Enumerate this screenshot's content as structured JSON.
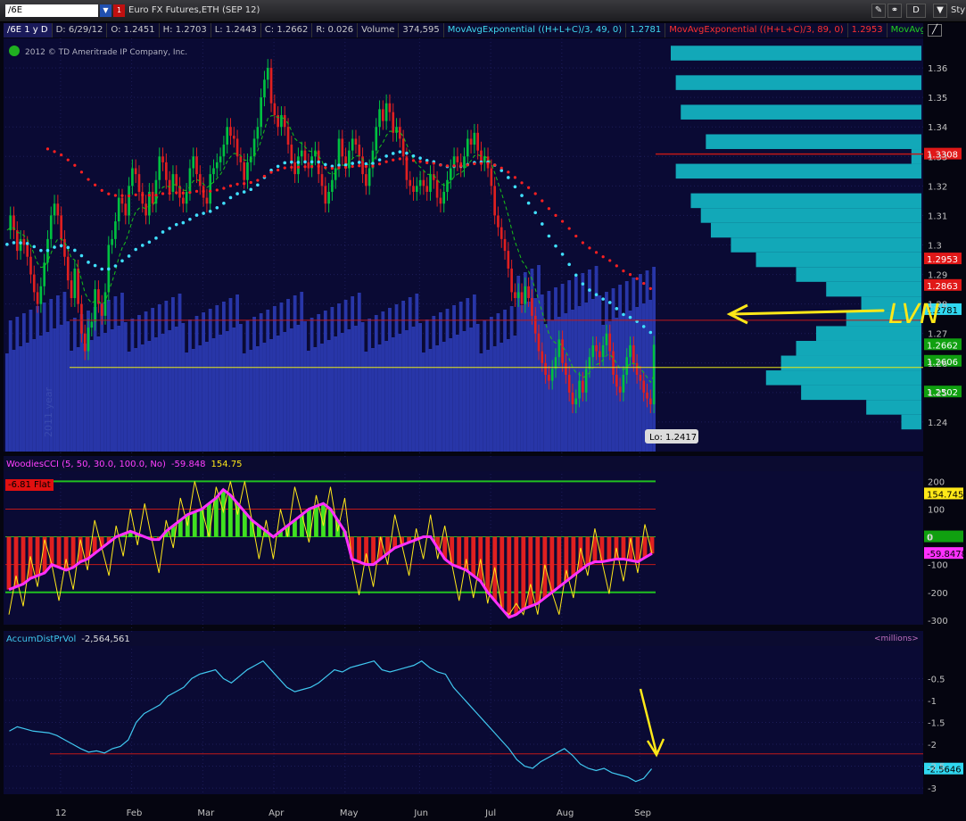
{
  "toolbar": {
    "symbol": "/6E",
    "title": "Euro FX Futures,ETH (SEP 12)",
    "style_label": "Sty",
    "d_button": "D"
  },
  "price_legend": {
    "symbol": "/6E 1 y D",
    "date": "D: 6/29/12",
    "open": "O: 1.2451",
    "high": "H: 1.2703",
    "low": "L: 1.2443",
    "close": "C: 1.2662",
    "range": "R: 0.026",
    "volume_label": "Volume",
    "volume_value": "374,595",
    "ema49_label": "MovAvgExponential ((H+L+C)/3, 49, 0)",
    "ema49_value": "1.2781",
    "ema89_label": "MovAvgExponential ((H+L+C)/3, 89, 0)",
    "ema89_value": "1.2953",
    "ema3_label": "MovAvgExponential..."
  },
  "copyright": "2012 © TD Ameritrade IP Company, Inc.",
  "year_watermark": "2011 year",
  "lo_label": "Lo: 1.2417",
  "annotation_text": "LVN",
  "cci_legend": {
    "label": "WoodiesCCI (5, 50, 30.0, 100.0, No)",
    "val1": "-59.848",
    "val2": "154.75",
    "flat_badge": "-6.81 Flat"
  },
  "ad_legend": {
    "label": "AccumDistPrVol",
    "value": "-2,564,561",
    "units": "<millions>"
  },
  "colors": {
    "background": "#0a0a34",
    "up_candle": "#00c040",
    "down_candle": "#e02020",
    "volume": "#2836a8",
    "ema49": "#40e0ff",
    "ema89": "#ff2020",
    "ema_fast": "#18c018",
    "volume_profile": "#12a8b8",
    "hline": "#c01818",
    "yellow": "#ffe818",
    "cci_thick": "#ff30ff",
    "ad_line": "#40c8f0"
  },
  "chart_data": [
    {
      "type": "candlestick",
      "name": "price",
      "ylim": [
        1.23,
        1.37
      ],
      "yticks": [
        "1.36",
        "1.35",
        "1.34",
        "1.33",
        "1.32",
        "1.31",
        "1.3",
        "1.29",
        "1.28",
        "1.27",
        "1.26",
        "1.25",
        "1.24"
      ],
      "x_ticks": [
        "12",
        "Feb",
        "Mar",
        "Apr",
        "May",
        "Jun",
        "Jul",
        "Aug",
        "Sep"
      ],
      "closes": [
        1.305,
        1.31,
        1.305,
        1.298,
        1.302,
        1.3,
        1.296,
        1.29,
        1.284,
        1.28,
        1.286,
        1.294,
        1.302,
        1.31,
        1.314,
        1.31,
        1.302,
        1.296,
        1.288,
        1.282,
        1.292,
        1.28,
        1.27,
        1.264,
        1.272,
        1.274,
        1.285,
        1.28,
        1.276,
        1.284,
        1.3,
        1.302,
        1.308,
        1.316,
        1.314,
        1.31,
        1.32,
        1.326,
        1.324,
        1.318,
        1.314,
        1.31,
        1.318,
        1.314,
        1.322,
        1.33,
        1.328,
        1.322,
        1.318,
        1.324,
        1.32,
        1.316,
        1.314,
        1.318,
        1.326,
        1.33,
        1.324,
        1.32,
        1.316,
        1.314,
        1.324,
        1.326,
        1.328,
        1.33,
        1.334,
        1.34,
        1.337,
        1.336,
        1.33,
        1.328,
        1.322,
        1.328,
        1.33,
        1.336,
        1.34,
        1.35,
        1.356,
        1.36,
        1.348,
        1.344,
        1.34,
        1.344,
        1.34,
        1.334,
        1.328,
        1.324,
        1.33,
        1.332,
        1.328,
        1.326,
        1.33,
        1.332,
        1.324,
        1.32,
        1.314,
        1.318,
        1.322,
        1.326,
        1.336,
        1.33,
        1.326,
        1.332,
        1.336,
        1.334,
        1.33,
        1.324,
        1.32,
        1.326,
        1.332,
        1.34,
        1.346,
        1.342,
        1.348,
        1.345,
        1.338,
        1.34,
        1.336,
        1.33,
        1.322,
        1.32,
        1.318,
        1.32,
        1.322,
        1.32,
        1.318,
        1.324,
        1.322,
        1.316,
        1.314,
        1.318,
        1.322,
        1.326,
        1.33,
        1.328,
        1.326,
        1.33,
        1.336,
        1.334,
        1.338,
        1.332,
        1.328,
        1.33,
        1.326,
        1.32,
        1.31,
        1.306,
        1.302,
        1.298,
        1.292,
        1.284,
        1.282,
        1.284,
        1.28,
        1.286,
        1.282,
        1.276,
        1.27,
        1.264,
        1.26,
        1.256,
        1.254,
        1.258,
        1.262,
        1.268,
        1.26,
        1.256,
        1.25,
        1.246,
        1.248,
        1.254,
        1.25,
        1.258,
        1.262,
        1.266,
        1.264,
        1.262,
        1.266,
        1.27,
        1.264,
        1.256,
        1.252,
        1.25,
        1.256,
        1.262,
        1.266,
        1.26,
        1.256,
        1.254,
        1.25,
        1.248,
        1.246,
        1.2662
      ],
      "ema_49": {
        "name": "MovAvgExponential 49",
        "start": 1.3,
        "end": 1.2781
      },
      "ema_89": {
        "name": "MovAvgExponential 89",
        "start": 1.345,
        "end": 1.2953
      },
      "price_labels": [
        {
          "value": "1.3308",
          "price": 1.3308,
          "color": "#e01818"
        },
        {
          "value": "1.2953",
          "price": 1.2953,
          "color": "#e01818"
        },
        {
          "value": "1.2863",
          "price": 1.2863,
          "color": "#e01818"
        },
        {
          "value": "1.2781",
          "price": 1.2781,
          "color": "#30d8f0"
        },
        {
          "value": "1.2662",
          "price": 1.2662,
          "color": "#10a010"
        },
        {
          "value": "1.2606",
          "price": 1.2606,
          "color": "#10a010"
        },
        {
          "value": "1.2502",
          "price": 1.2502,
          "color": "#10a010"
        }
      ],
      "hlines": [
        {
          "price": 1.2745,
          "color": "#c01818"
        },
        {
          "price": 1.2585,
          "color": "#e8e818"
        }
      ],
      "volume_profile": [
        {
          "price": 1.365,
          "size": 1.0
        },
        {
          "price": 1.355,
          "size": 0.98
        },
        {
          "price": 1.345,
          "size": 0.96
        },
        {
          "price": 1.335,
          "size": 0.86
        },
        {
          "price": 1.33,
          "size": 0.04
        },
        {
          "price": 1.325,
          "size": 0.98
        },
        {
          "price": 1.315,
          "size": 0.92
        },
        {
          "price": 1.31,
          "size": 0.88
        },
        {
          "price": 1.305,
          "size": 0.84
        },
        {
          "price": 1.3,
          "size": 0.76
        },
        {
          "price": 1.295,
          "size": 0.66
        },
        {
          "price": 1.29,
          "size": 0.5
        },
        {
          "price": 1.285,
          "size": 0.38
        },
        {
          "price": 1.28,
          "size": 0.24
        },
        {
          "price": 1.275,
          "size": 0.3
        },
        {
          "price": 1.27,
          "size": 0.42
        },
        {
          "price": 1.265,
          "size": 0.5
        },
        {
          "price": 1.26,
          "size": 0.56
        },
        {
          "price": 1.255,
          "size": 0.62
        },
        {
          "price": 1.25,
          "size": 0.48
        },
        {
          "price": 1.245,
          "size": 0.22
        },
        {
          "price": 1.24,
          "size": 0.08
        }
      ]
    },
    {
      "type": "line",
      "name": "WoodiesCCI",
      "ylim": [
        -310,
        230
      ],
      "yticks": [
        "200",
        "100",
        "0",
        "-100",
        "-200",
        "-300"
      ],
      "levels": [
        200,
        100,
        0,
        -100,
        -200
      ],
      "value_labels": [
        {
          "value": "154.745",
          "level": 154.7,
          "color": "#ffe818",
          "text_color": "#000"
        },
        {
          "value": "0",
          "level": 0,
          "color": "#10a010",
          "text_color": "#fff"
        },
        {
          "value": "-59.8478",
          "level": -59.8,
          "color": "#ff30ff",
          "text_color": "#000"
        }
      ],
      "cci_50": [
        -190,
        -180,
        -170,
        -150,
        -140,
        -130,
        -100,
        -110,
        -120,
        -110,
        -90,
        -80,
        -60,
        -40,
        -20,
        0,
        10,
        20,
        10,
        0,
        -10,
        -10,
        20,
        40,
        60,
        80,
        90,
        100,
        120,
        140,
        170,
        150,
        120,
        90,
        60,
        40,
        20,
        0,
        20,
        40,
        60,
        80,
        100,
        110,
        120,
        100,
        60,
        20,
        -80,
        -90,
        -100,
        -100,
        -80,
        -60,
        -40,
        -30,
        -20,
        -10,
        0,
        0,
        -40,
        -80,
        -100,
        -110,
        -120,
        -140,
        -160,
        -200,
        -230,
        -260,
        -290,
        -280,
        -260,
        -250,
        -240,
        -220,
        -200,
        -180,
        -160,
        -140,
        -120,
        -100,
        -90,
        -90,
        -85,
        -80,
        -80,
        -85,
        -90,
        -75,
        -60
      ]
    },
    {
      "type": "line",
      "name": "AccumDistPrVol",
      "ylim": [
        -3.1,
        0.2
      ],
      "yticks": [
        "-0.5",
        "-1",
        "-1.5",
        "-2",
        "-2.5",
        "-3"
      ],
      "value_label": {
        "value": "-2.5646",
        "level": -2.5646
      },
      "hline": -2.22,
      "values": [
        -1.7,
        -1.6,
        -1.65,
        -1.7,
        -1.72,
        -1.74,
        -1.8,
        -1.9,
        -2.0,
        -2.1,
        -2.18,
        -2.15,
        -2.2,
        -2.1,
        -2.05,
        -1.9,
        -1.5,
        -1.3,
        -1.2,
        -1.1,
        -0.9,
        -0.8,
        -0.7,
        -0.5,
        -0.4,
        -0.35,
        -0.3,
        -0.5,
        -0.6,
        -0.45,
        -0.3,
        -0.2,
        -0.1,
        -0.3,
        -0.5,
        -0.7,
        -0.8,
        -0.75,
        -0.7,
        -0.6,
        -0.45,
        -0.3,
        -0.35,
        -0.25,
        -0.2,
        -0.15,
        -0.1,
        -0.3,
        -0.35,
        -0.3,
        -0.25,
        -0.2,
        -0.1,
        -0.25,
        -0.35,
        -0.4,
        -0.7,
        -0.9,
        -1.1,
        -1.3,
        -1.5,
        -1.7,
        -1.9,
        -2.1,
        -2.35,
        -2.5,
        -2.55,
        -2.4,
        -2.3,
        -2.2,
        -2.1,
        -2.25,
        -2.45,
        -2.55,
        -2.6,
        -2.55,
        -2.65,
        -2.7,
        -2.75,
        -2.85,
        -2.78,
        -2.56
      ]
    }
  ]
}
